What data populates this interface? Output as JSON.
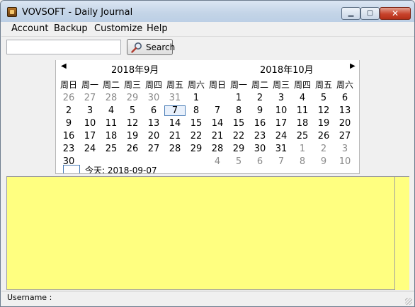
{
  "window": {
    "title": "VOVSOFT - Daily Journal",
    "minimize": "▁",
    "maximize": "▢",
    "close": "✕"
  },
  "menu": [
    "Account",
    "Backup",
    "Customize",
    "Help"
  ],
  "search": {
    "value": "",
    "placeholder": "",
    "button_label": "Search"
  },
  "calendar": {
    "prev_label": "◀",
    "next_label": "▶",
    "weekdays": [
      "周日",
      "周一",
      "周二",
      "周三",
      "周四",
      "周五",
      "周六"
    ],
    "months": [
      {
        "title": "2018年9月",
        "weeks": [
          [
            "26",
            "27",
            "28",
            "29",
            "30",
            "31",
            "1"
          ],
          [
            "2",
            "3",
            "4",
            "5",
            "6",
            "7",
            "8"
          ],
          [
            "9",
            "10",
            "11",
            "12",
            "13",
            "14",
            "15"
          ],
          [
            "16",
            "17",
            "18",
            "19",
            "20",
            "21",
            "22"
          ],
          [
            "23",
            "24",
            "25",
            "26",
            "27",
            "28",
            "29"
          ],
          [
            "30",
            "",
            "",
            "",
            "",
            "",
            ""
          ]
        ],
        "gray": [
          [
            0,
            0
          ],
          [
            0,
            1
          ],
          [
            0,
            2
          ],
          [
            0,
            3
          ],
          [
            0,
            4
          ],
          [
            0,
            5
          ]
        ],
        "selected": [
          1,
          5
        ]
      },
      {
        "title": "2018年10月",
        "weeks": [
          [
            "",
            "1",
            "2",
            "3",
            "4",
            "5",
            "6"
          ],
          [
            "7",
            "8",
            "9",
            "10",
            "11",
            "12",
            "13"
          ],
          [
            "14",
            "15",
            "16",
            "17",
            "18",
            "19",
            "20"
          ],
          [
            "21",
            "22",
            "23",
            "24",
            "25",
            "26",
            "27"
          ],
          [
            "28",
            "29",
            "30",
            "31",
            "1",
            "2",
            "3"
          ],
          [
            "4",
            "5",
            "6",
            "7",
            "8",
            "9",
            "10"
          ]
        ],
        "gray": [
          [
            4,
            4
          ],
          [
            4,
            5
          ],
          [
            4,
            6
          ],
          [
            5,
            0
          ],
          [
            5,
            1
          ],
          [
            5,
            2
          ],
          [
            5,
            3
          ],
          [
            5,
            4
          ],
          [
            5,
            5
          ],
          [
            5,
            6
          ]
        ],
        "selected": null
      }
    ],
    "today_label": "今天: 2018-09-07"
  },
  "editor": {
    "text": "",
    "background": "#ffff80"
  },
  "status": {
    "text": "Username :"
  }
}
